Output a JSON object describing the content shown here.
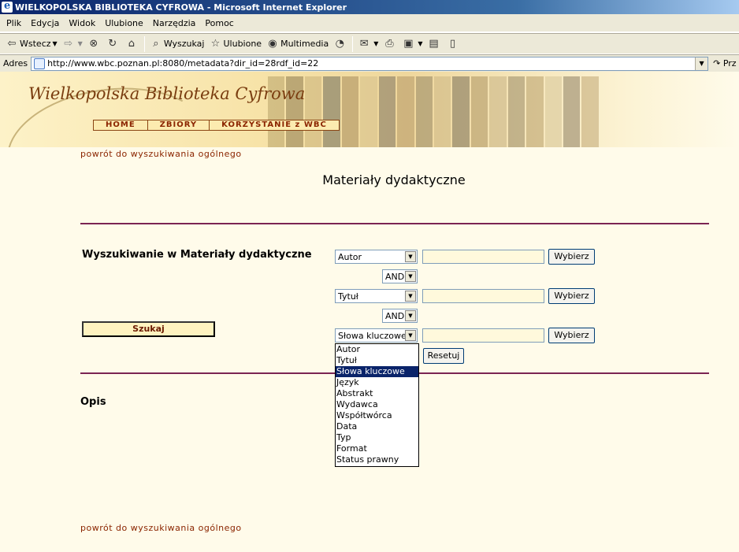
{
  "window": {
    "title": "WIELKOPOLSKA BIBLIOTEKA CYFROWA - Microsoft Internet Explorer"
  },
  "menu": [
    "Plik",
    "Edycja",
    "Widok",
    "Ulubione",
    "Narzędzia",
    "Pomoc"
  ],
  "toolbar": {
    "back": "Wstecz",
    "search": "Wyszukaj",
    "favorites": "Ulubione",
    "multimedia": "Multimedia"
  },
  "address": {
    "label": "Adres",
    "url": "http://www.wbc.poznan.pl:8080/metadata?dir_id=28rdf_id=22",
    "go": "Prz"
  },
  "site": {
    "title": "Wielkopolska Biblioteka Cyfrowa",
    "nav": [
      "HOME",
      "ZBIORY",
      "KORZYSTANIE z WBC"
    ]
  },
  "page": {
    "back_link": "powrót do wyszukiwania ogólnego",
    "heading": "Materiały dydaktyczne",
    "search_title": "Wyszukiwanie w Materiały dydaktyczne",
    "search_button": "Szukaj",
    "description_title": "Opis"
  },
  "form": {
    "rows": [
      {
        "field": "Autor",
        "value": "",
        "choose": "Wybierz"
      },
      {
        "field": "Tytuł",
        "value": "",
        "choose": "Wybierz"
      },
      {
        "field": "Słowa kluczowe",
        "value": "",
        "choose": "Wybierz"
      }
    ],
    "operators": [
      "AND",
      "AND"
    ],
    "reset": "Resetuj",
    "dropdown_options": [
      "Autor",
      "Tytuł",
      "Słowa kluczowe",
      "Język",
      "Abstrakt",
      "Wydawca",
      "Współtwórca",
      "Data",
      "Typ",
      "Format",
      "Status prawny"
    ],
    "dropdown_selected_index": 2
  },
  "colors": {
    "accent": "#7b2453",
    "link": "#8b2500",
    "background": "#fffbea"
  }
}
